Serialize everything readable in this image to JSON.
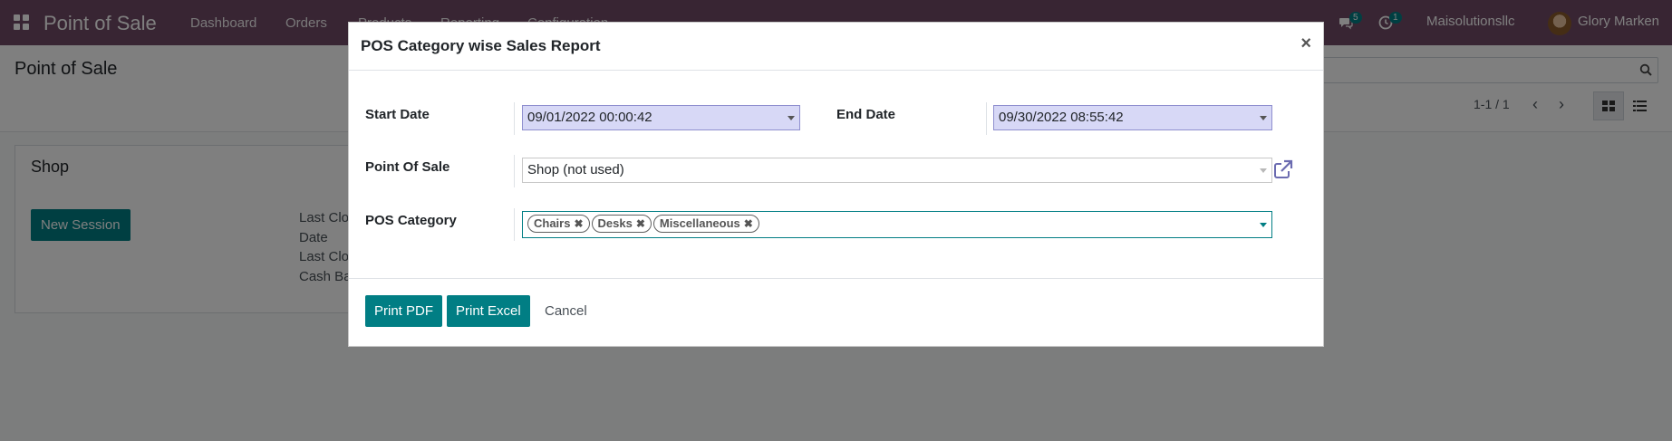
{
  "navbar": {
    "app_title": "Point of Sale",
    "menus": [
      "Dashboard",
      "Orders",
      "Products",
      "Reporting",
      "Configuration"
    ],
    "messages_count": "5",
    "activities_count": "1",
    "company": "Maisolutionsllc",
    "user": "Glory Marken"
  },
  "control_panel": {
    "title": "Point of Sale",
    "pager": "1-1 / 1"
  },
  "card": {
    "title": "Shop",
    "new_session_label": "New Session",
    "labels": [
      "Last Clos",
      "Date",
      "Last Clos",
      "Cash Ba"
    ]
  },
  "dialog": {
    "title": "POS Category wise Sales Report",
    "start_date_label": "Start Date",
    "start_date_value": "09/01/2022 00:00:42",
    "end_date_label": "End Date",
    "end_date_value": "09/30/2022 08:55:42",
    "pos_label": "Point Of Sale",
    "pos_value": "Shop (not used)",
    "category_label": "POS Category",
    "categories": [
      "Chairs",
      "Desks",
      "Miscellaneous"
    ],
    "print_pdf_label": "Print PDF",
    "print_excel_label": "Print Excel",
    "cancel_label": "Cancel"
  },
  "colors": {
    "navbar": "#714b67",
    "primary": "#017e84",
    "date_field": "#d7d8f6"
  }
}
